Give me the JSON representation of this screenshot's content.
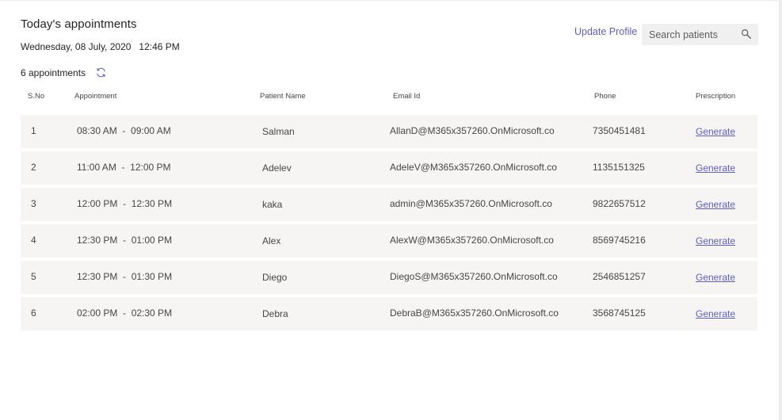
{
  "header": {
    "title": "Today's appointments",
    "datetime": "Wednesday, 08 July, 2020   12:46 PM",
    "appointment_count": "6 appointments",
    "update_profile_label": "Update Profile",
    "search_placeholder": "Search patients"
  },
  "table": {
    "columns": [
      "S.No",
      "Appointment",
      "Patient Name",
      "Email Id",
      "Phone",
      "Prescription"
    ],
    "rows": [
      {
        "sno": "1",
        "appointment": "08:30 AM  -  09:00 AM",
        "patient": "Salman",
        "email": "AllanD@M365x357260.OnMicrosoft.co",
        "phone": "7350451481",
        "action": "Generate"
      },
      {
        "sno": "2",
        "appointment": "11:00 AM  -  12:00 PM",
        "patient": "Adelev",
        "email": "AdeleV@M365x357260.OnMicrosoft.co",
        "phone": "1135151325",
        "action": "Generate"
      },
      {
        "sno": "3",
        "appointment": "12:00 PM  -  12:30 PM",
        "patient": "kaka",
        "email": "admin@M365x357260.OnMicrosoft.co",
        "phone": "9822657512",
        "action": "Generate"
      },
      {
        "sno": "4",
        "appointment": "12:30 PM  -  01:00 PM",
        "patient": "Alex",
        "email": "AlexW@M365x357260.OnMicrosoft.co",
        "phone": "8569745216",
        "action": "Generate"
      },
      {
        "sno": "5",
        "appointment": "12:30 PM  -  01:30 PM",
        "patient": "Diego",
        "email": "DiegoS@M365x357260.OnMicrosoft.co",
        "phone": "2546851257",
        "action": "Generate"
      },
      {
        "sno": "6",
        "appointment": "02:00 PM  -  02:30 PM",
        "patient": "Debra",
        "email": "DebraB@M365x357260.OnMicrosoft.co",
        "phone": "3568745125",
        "action": "Generate"
      }
    ]
  },
  "icons": {
    "refresh": "refresh-icon",
    "search": "search-icon"
  },
  "colors": {
    "accent": "#5b5fc7",
    "row_background": "#f6f5f4",
    "text": "#252423"
  }
}
